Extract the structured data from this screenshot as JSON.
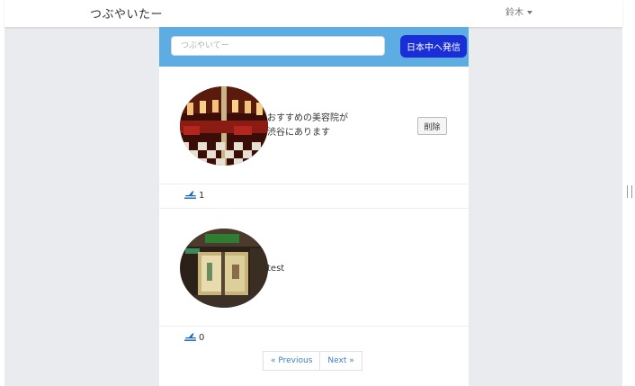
{
  "navbar": {
    "brand": "つぶやいたー",
    "user_name": "鈴木"
  },
  "composer": {
    "placeholder": "つぶやいてー",
    "submit_label": "日本中へ発信"
  },
  "posts": [
    {
      "text": "おすすめの美容院が\n渋谷にあります",
      "delete_label": "削除",
      "like_count": "1",
      "avatar": "salon-interior-photo"
    },
    {
      "text": "test",
      "like_count": "0",
      "avatar": "shop-storefront-photo"
    }
  ],
  "pagination": {
    "previous_label": "« Previous",
    "next_label": "Next »"
  },
  "colors": {
    "composer_bg": "#5dade2",
    "submit_bg": "#1a2ed8",
    "like_icon": "#1565c0",
    "page_bg": "#e9ebee"
  },
  "icons": {
    "like": "airplane-departure-icon",
    "dropdown": "caret-down-icon"
  }
}
